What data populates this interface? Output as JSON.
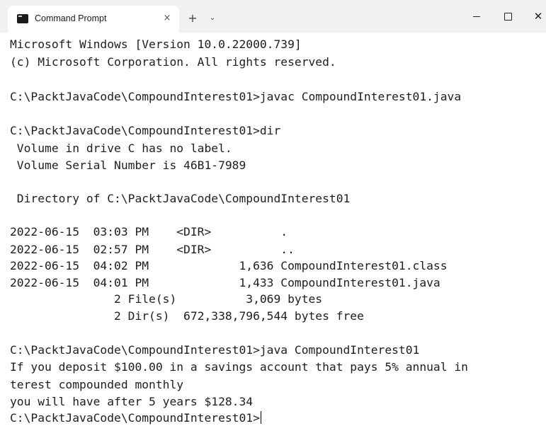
{
  "window": {
    "tab_title": "Command Prompt",
    "tab_close": "×",
    "new_tab": "+",
    "dropdown": "⌄",
    "minimize": "—",
    "maximize": "☐",
    "close": "✕"
  },
  "console": {
    "lines": [
      "Microsoft Windows [Version 10.0.22000.739]",
      "(c) Microsoft Corporation. All rights reserved.",
      "",
      "C:\\PacktJavaCode\\CompoundInterest01>javac CompoundInterest01.java",
      "",
      "C:\\PacktJavaCode\\CompoundInterest01>dir",
      " Volume in drive C has no label.",
      " Volume Serial Number is 46B1-7989",
      "",
      " Directory of C:\\PacktJavaCode\\CompoundInterest01",
      "",
      "2022-06-15  03:03 PM    <DIR>          .",
      "2022-06-15  02:57 PM    <DIR>          ..",
      "2022-06-15  04:02 PM             1,636 CompoundInterest01.class",
      "2022-06-15  04:01 PM             1,433 CompoundInterest01.java",
      "               2 File(s)          3,069 bytes",
      "               2 Dir(s)  672,338,796,544 bytes free",
      "",
      "C:\\PacktJavaCode\\CompoundInterest01>java CompoundInterest01",
      "If you deposit $100.00 in a savings account that pays 5% annual in",
      "terest compounded monthly",
      "you will have after 5 years $128.34",
      "C:\\PacktJavaCode\\CompoundInterest01>"
    ]
  },
  "colors": {
    "titlebar_bg": "#f1f1f1",
    "console_bg": "#ffffff",
    "console_text": "#1e1e1e"
  }
}
